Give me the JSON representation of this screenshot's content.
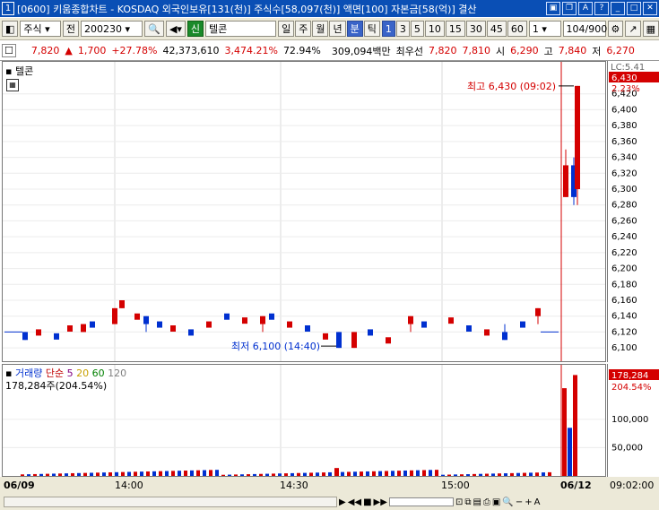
{
  "window": {
    "number": "1",
    "title": "[0600] 키움종합차트 - KOSDAQ 외국인보유[131(천)] 주식수[58,097(천)] 액면[100] 자본금[58(억)] 결산"
  },
  "toolbar": {
    "market": "주식",
    "prev_label": "전",
    "code": "200230",
    "credit_badge": "신",
    "stock_name": "텔콘",
    "periods": [
      "일",
      "주",
      "월",
      "년",
      "분",
      "틱"
    ],
    "active_period": "분",
    "intervals": [
      "1",
      "3",
      "5",
      "10",
      "15",
      "30",
      "45",
      "60"
    ],
    "active_interval": "1",
    "multiplier": "1",
    "counter": "104/900"
  },
  "info": {
    "price": "7,820",
    "change": "1,700",
    "change_pct": "+27.78%",
    "volume": "42,373,610",
    "vol_ratio": "3,474.21%",
    "rate": "72.94%",
    "amount": "309,094백만",
    "best_bid_label": "최우선",
    "ask": "7,820",
    "bid": "7,810",
    "open_label": "시",
    "open": "6,290",
    "high_label": "고",
    "high": "7,840",
    "low_label": "저",
    "low": "6,270"
  },
  "colors": {
    "up": "#d40000",
    "down": "#0030d0",
    "ma5": "#c8a000",
    "ma20": "#e07000",
    "ma60": "#008000",
    "ma120": "#808080"
  },
  "price_pane": {
    "stock_label": "텔콘",
    "last_price_tag": "6,430",
    "last_pct_tag": "2.23%",
    "lc_label": "LC:5.41",
    "high_annotation": "최고 6,430 (09:02)",
    "low_annotation": "최저 6,100 (14:40)"
  },
  "volume_pane": {
    "title": "거래량",
    "ma_label": "단순",
    "ma_periods": [
      "5",
      "20",
      "60",
      "120"
    ],
    "info": "178,284주(204.54%)",
    "last_value_tag": "178,284",
    "last_pct_tag": "204.54%"
  },
  "x_labels": [
    "06/09",
    "14:00",
    "14:30",
    "15:00",
    "06/12",
    "09:02:00"
  ],
  "chart_data": [
    {
      "type": "candlestick",
      "title": "텔콘",
      "y_ticks": [
        "6,420",
        "6,400",
        "6,380",
        "6,360",
        "6,340",
        "6,320",
        "6,300",
        "6,280",
        "6,260",
        "6,240",
        "6,220",
        "6,200",
        "6,180",
        "6,160",
        "6,140",
        "6,120",
        "6,100"
      ],
      "ylim": [
        6090,
        6440
      ],
      "x_labels": [
        "06/09",
        "14:00",
        "14:30",
        "15:00",
        "06/12"
      ],
      "session_1_close_flat": 6120,
      "candles": [
        {
          "t": "06/09 13:37",
          "o": 6120,
          "h": 6120,
          "l": 6110,
          "c": 6110
        },
        {
          "t": "06/09 13:40",
          "o": 6120,
          "h": 6130,
          "l": 6120,
          "c": 6130
        },
        {
          "t": "06/09 13:50",
          "o": 6130,
          "h": 6150,
          "l": 6130,
          "c": 6150
        },
        {
          "t": "06/09 13:58",
          "o": 6150,
          "h": 6160,
          "l": 6150,
          "c": 6160
        },
        {
          "t": "06/09 14:10",
          "o": 6140,
          "h": 6140,
          "l": 6120,
          "c": 6130
        },
        {
          "t": "06/09 14:25",
          "o": 6130,
          "h": 6140,
          "l": 6120,
          "c": 6140
        },
        {
          "t": "06/09 14:40",
          "o": 6120,
          "h": 6120,
          "l": 6100,
          "c": 6100
        },
        {
          "t": "06/09 14:45",
          "o": 6100,
          "h": 6120,
          "l": 6100,
          "c": 6120
        },
        {
          "t": "06/09 15:00",
          "o": 6130,
          "h": 6140,
          "l": 6120,
          "c": 6140
        },
        {
          "t": "06/09 15:15",
          "o": 6120,
          "h": 6130,
          "l": 6110,
          "c": 6110
        },
        {
          "t": "06/09 15:20",
          "o": 6140,
          "h": 6150,
          "l": 6130,
          "c": 6150
        },
        {
          "t": "06/12 09:00",
          "o": 6290,
          "h": 6350,
          "l": 6290,
          "c": 6330
        },
        {
          "t": "06/12 09:01",
          "o": 6330,
          "h": 6340,
          "l": 6280,
          "c": 6290
        },
        {
          "t": "06/12 09:02",
          "o": 6300,
          "h": 6430,
          "l": 6280,
          "c": 6430
        }
      ]
    },
    {
      "type": "bar",
      "title": "거래량",
      "y_ticks": [
        "100,000",
        "50,000"
      ],
      "ylim": [
        0,
        190000
      ],
      "last_values": [
        {
          "t": "06/12 09:00",
          "v": 155000
        },
        {
          "t": "06/12 09:01",
          "v": 85000
        },
        {
          "t": "06/12 09:02",
          "v": 178284
        }
      ],
      "last_volume": 178284
    }
  ]
}
